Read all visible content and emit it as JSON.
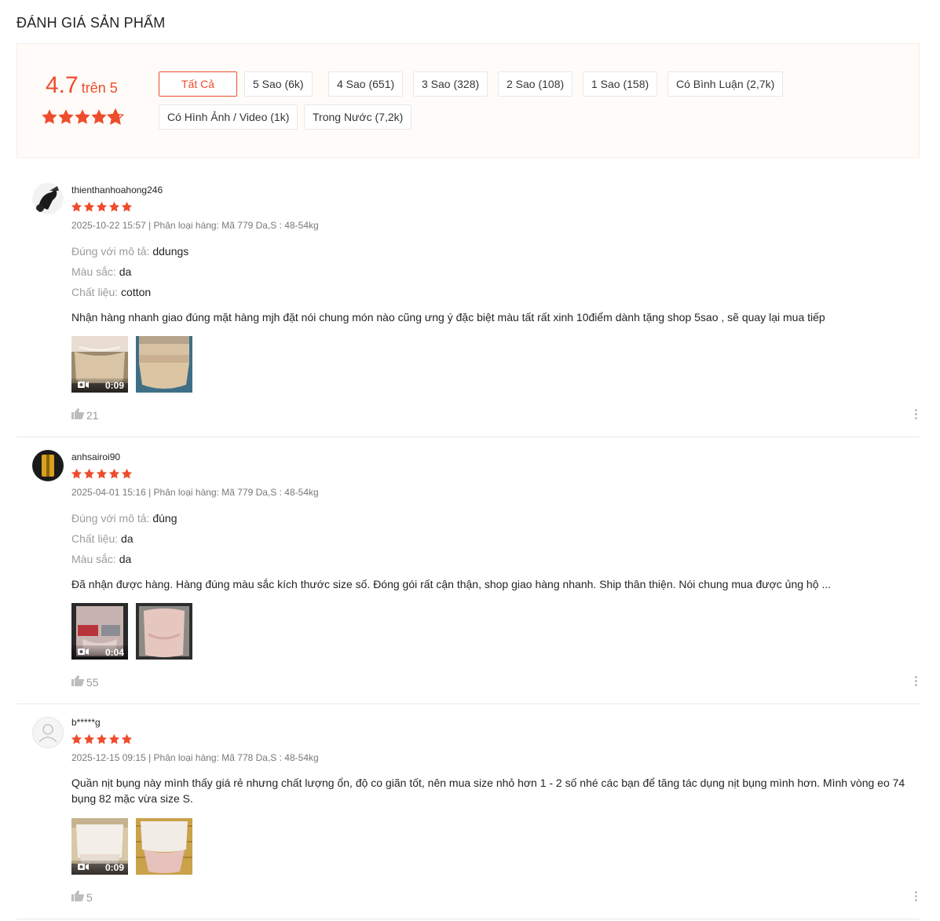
{
  "title": "ĐÁNH GIÁ SẢN PHẨM",
  "overview": {
    "rating": "4.7",
    "rating_suffix": "trên 5",
    "stars": 4.7,
    "filters": [
      {
        "label": "Tất Cả",
        "active": true
      },
      {
        "label": "5 Sao (6k)",
        "active": false
      },
      {
        "label": "4 Sao (651)",
        "active": false
      },
      {
        "label": "3 Sao (328)",
        "active": false
      },
      {
        "label": "2 Sao (108)",
        "active": false
      },
      {
        "label": "1 Sao (158)",
        "active": false
      },
      {
        "label": "Có Bình Luận (2,7k)",
        "active": false
      },
      {
        "label": "Có Hình Ảnh / Video (1k)",
        "active": false
      },
      {
        "label": "Trong Nước (7,2k)",
        "active": false
      }
    ]
  },
  "colors": {
    "accent": "#ee4d2d",
    "star": "#ee4d2d"
  },
  "reviews": [
    {
      "username": "thienthanhoahong246",
      "stars": 5,
      "meta": "2025-10-22 15:57 | Phân loại hàng: Mã 779 Da,S : 48-54kg",
      "attributes": [
        {
          "key": "Đúng với mô tả:",
          "value": "ddungs"
        },
        {
          "key": "Màu sắc:",
          "value": "da"
        },
        {
          "key": "Chất liệu:",
          "value": "cotton"
        }
      ],
      "comment": "Nhận hàng nhanh giao đúng mặt hàng mjh đặt nói chung món nào cũng ưng ý đặc biệt màu tất rất xinh 10điểm dành tặng shop 5sao , sẽ quay lại mua tiếp",
      "video_duration": "0:09",
      "likes": "21"
    },
    {
      "username": "anhsairoi90",
      "stars": 5,
      "meta": "2025-04-01 15:16 | Phân loại hàng: Mã 779 Da,S : 48-54kg",
      "attributes": [
        {
          "key": "Đúng với mô tả:",
          "value": "đúng"
        },
        {
          "key": "Chất liệu:",
          "value": "da"
        },
        {
          "key": "Màu sắc:",
          "value": "da"
        }
      ],
      "comment": "Đã nhận được hàng. Hàng đúng màu sắc kích thước size số. Đóng gói rất cận thận, shop giao hàng nhanh. Ship thân thiện. Nói chung mua được ủng hộ ...",
      "video_duration": "0:04",
      "likes": "55"
    },
    {
      "username": "b*****g",
      "stars": 5,
      "meta": "2025-12-15 09:15 | Phân loại hàng: Mã 778 Da,S : 48-54kg",
      "attributes": [],
      "comment": "Quần nịt bụng này mình thấy giá rẻ nhưng chất lượng ổn, độ co giãn tốt, nên mua size nhỏ hơn 1 - 2 số nhé các bạn để tăng tác dụng nịt bụng mình hơn. Mình vòng eo 74 bụng 82 mặc vừa size S.",
      "video_duration": "0:09",
      "likes": "5"
    }
  ]
}
